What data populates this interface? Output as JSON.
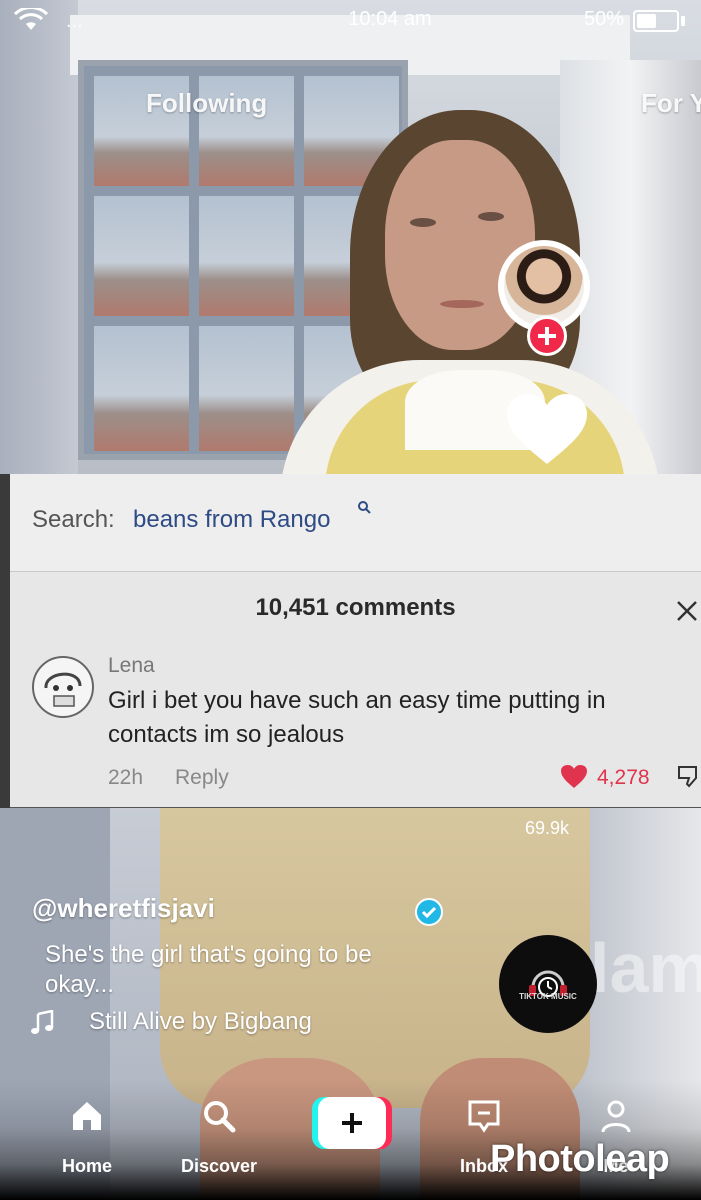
{
  "status_bar": {
    "carrier": "...",
    "time": "10:04 am",
    "battery_pct": "50%",
    "battery_level": 0.5
  },
  "feed_tabs": {
    "following": "Following",
    "for_you": "For Y"
  },
  "actions": {
    "like_count": "69.9k"
  },
  "comment_overlay": {
    "search_label": "Search:",
    "search_query": "beans from Rango",
    "comments_count": "10,451 comments",
    "commenter": "Lena",
    "comment_text": "Girl i bet you have such an easy time putting in contacts im so jealous",
    "time_ago": "22h",
    "reply_label": "Reply",
    "likes": "4,278",
    "heart_color": "#e0344e"
  },
  "caption": {
    "username": "@wheretfisjavi",
    "text": "She's the girl that's going to be okay...",
    "music": "Still Alive by Bigbang",
    "disc_label": "TIKTOK MUSIC"
  },
  "bottom_nav": {
    "home": "Home",
    "discover": "Discover",
    "inbox": "Inbox",
    "me": "Me"
  },
  "watermark": "Photoleap",
  "background_sign": "lam",
  "colors": {
    "tiktok_red": "#fe2c55",
    "tiktok_cyan": "#25f4ee",
    "verified": "#22b8e6"
  }
}
